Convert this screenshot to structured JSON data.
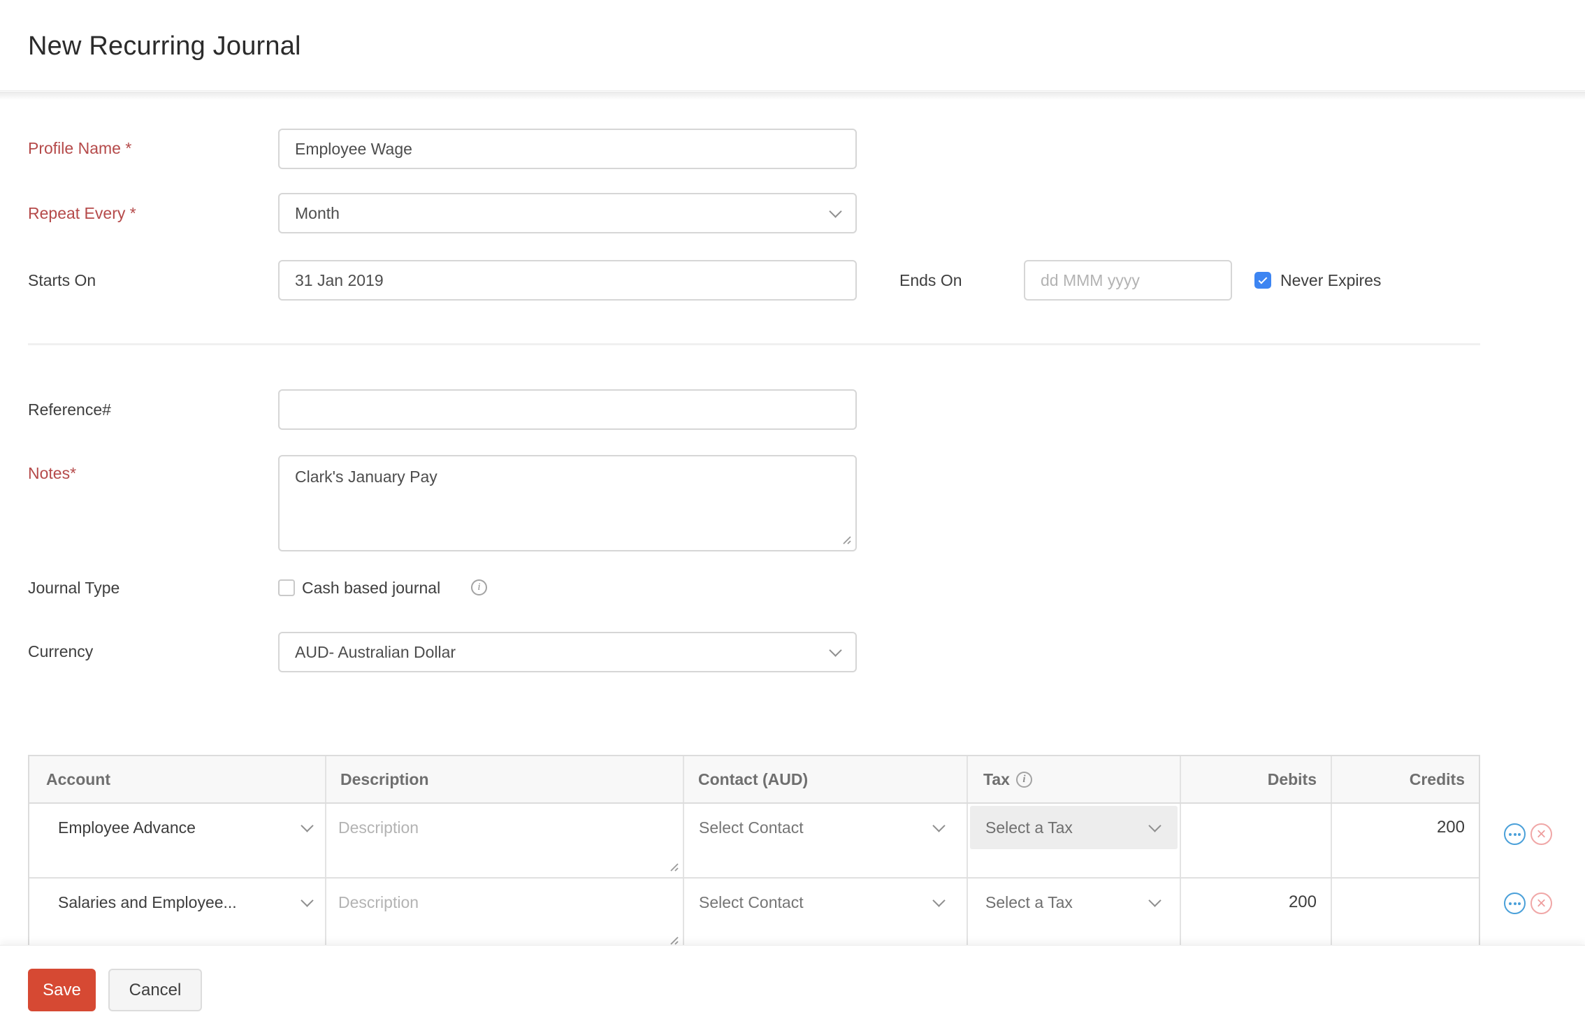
{
  "page": {
    "title": "New Recurring Journal"
  },
  "form": {
    "profile_name": {
      "label": "Profile Name *",
      "value": "Employee Wage"
    },
    "repeat_every": {
      "label": "Repeat Every *",
      "value": "Month"
    },
    "starts_on": {
      "label": "Starts On",
      "value": "31 Jan 2019"
    },
    "ends_on": {
      "label": "Ends On",
      "placeholder": "dd MMM yyyy"
    },
    "never_expires": {
      "label": "Never Expires",
      "checked": true
    },
    "reference": {
      "label": "Reference#",
      "value": ""
    },
    "notes": {
      "label": "Notes*",
      "value": "Clark's January Pay"
    },
    "journal_type": {
      "label": "Journal Type",
      "checkbox_label": "Cash based journal",
      "checked": false
    },
    "currency": {
      "label": "Currency",
      "value": "AUD- Australian Dollar"
    }
  },
  "table": {
    "headers": {
      "account": "Account",
      "description": "Description",
      "contact": "Contact (AUD)",
      "tax": "Tax",
      "debits": "Debits",
      "credits": "Credits"
    },
    "rows": [
      {
        "account": "Employee Advance",
        "description_placeholder": "Description",
        "contact_placeholder": "Select Contact",
        "tax_placeholder": "Select a Tax",
        "debits": "",
        "credits": "200"
      },
      {
        "account": "Salaries and Employee...",
        "description_placeholder": "Description",
        "contact_placeholder": "Select Contact",
        "tax_placeholder": "Select a Tax",
        "debits": "200",
        "credits": ""
      }
    ]
  },
  "footer": {
    "save_label": "Save",
    "cancel_label": "Cancel"
  },
  "icons": {
    "info_glyph": "i",
    "close_glyph": "×"
  },
  "colors": {
    "required_label": "#b54a4a",
    "save_button": "#d64933",
    "checkbox_checked": "#3d85f2",
    "row_action_blue": "#4aa0d9",
    "row_action_pink": "#f0a7a7"
  }
}
